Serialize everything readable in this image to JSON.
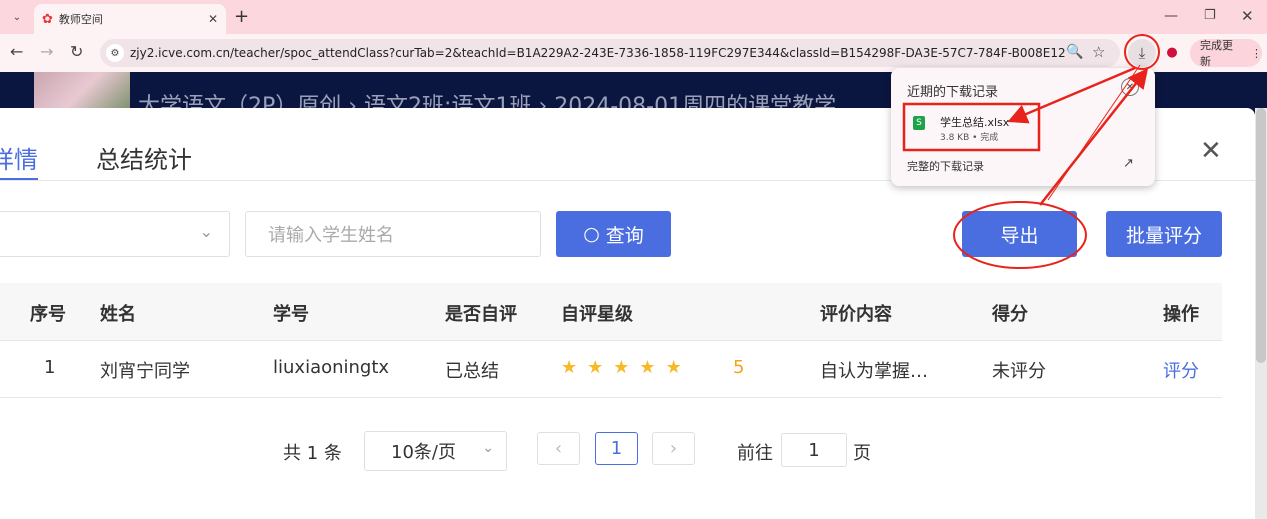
{
  "browser": {
    "tab_title": "教师空间",
    "new_tab": "+",
    "url": "zjy2.icve.com.cn/teacher/spoc_attendClass?curTab=2&teachId=B1A229A2-243E-7336-1858-119FC297E344&classId=B154298F-DA3E-57C7-784F-B008E1247620%3BB...",
    "update_button": "完成更新"
  },
  "downloads": {
    "title": "近期的下载记录",
    "file_name": "学生总结.xlsx",
    "file_meta": "3.8 KB • 完成",
    "full_history": "完整的下载记录"
  },
  "page": {
    "breadcrumb": "大学语文（2P）原创 › 语文2班;语文1班 › 2024-08-01周四的课堂教学"
  },
  "modal": {
    "tabs": [
      {
        "label": "详情",
        "active": true
      },
      {
        "label": "总结统计",
        "active": false
      }
    ],
    "search_placeholder": "请输入学生姓名",
    "query_button": "查询",
    "export_button": "导出",
    "batch_button": "批量评分",
    "table": {
      "headers": [
        "序号",
        "姓名",
        "学号",
        "是否自评",
        "自评星级",
        "评价内容",
        "得分",
        "操作"
      ],
      "rows": [
        {
          "index": "1",
          "name": "刘宵宁同学",
          "id": "liuxiaoningtx",
          "self_eval": "已总结",
          "stars": 5,
          "stars_label": "5",
          "content": "自认为掌握…",
          "score": "未评分",
          "action": "评分"
        }
      ]
    },
    "pagination": {
      "total": "共 1 条",
      "page_size": "10条/页",
      "current": "1",
      "goto_label": "前往",
      "goto_value": "1",
      "page_suffix": "页"
    }
  },
  "colors": {
    "accent": "#4a6ee0",
    "star": "#f7b924",
    "annotation": "#e8231b"
  }
}
